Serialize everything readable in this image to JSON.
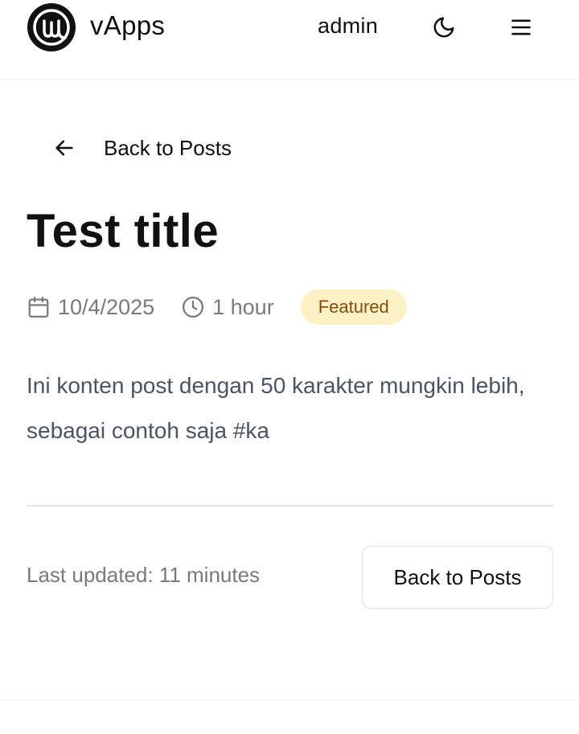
{
  "header": {
    "app_name": "vApps",
    "username": "admin",
    "logo_icon": "logo-at-icon",
    "theme_icon": "moon-icon",
    "menu_icon": "hamburger-menu-icon"
  },
  "nav": {
    "back_label": "Back to Posts",
    "back_icon": "arrow-left-icon"
  },
  "post": {
    "title": "Test title",
    "date": "10/4/2025",
    "date_icon": "calendar-icon",
    "duration": "1 hour",
    "duration_icon": "clock-icon",
    "badge": "Featured",
    "content": "Ini konten post dengan 50 karakter mungkin lebih, sebagai contoh saja #ka"
  },
  "footer": {
    "last_updated": "Last updated: 11 minutes",
    "back_button_label": "Back to Posts"
  },
  "colors": {
    "badge_bg": "#fdf1c6",
    "badge_text": "#8a4a0c",
    "content_text": "#4a5563",
    "muted_text": "#7a7a7a"
  }
}
